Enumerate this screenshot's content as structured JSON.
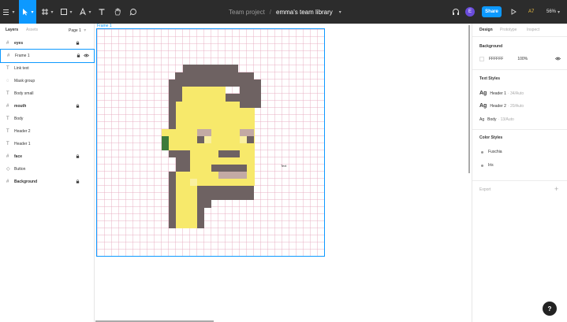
{
  "toolbar": {
    "project": "Team project",
    "separator": "/",
    "file_name": "emma's team library",
    "avatar_initial": "E",
    "share_label": "Share",
    "multiplayer_label": "A7",
    "zoom": "56%"
  },
  "left_panel": {
    "tabs": [
      "Layers",
      "Assets"
    ],
    "page_selector": "Page 1",
    "layers": [
      {
        "name": "eyes",
        "icon": "frame-grid-icon",
        "bold": true,
        "locked": true
      },
      {
        "name": "Frame 1",
        "icon": "frame-grid-icon",
        "bold": false,
        "locked": true,
        "selected": true,
        "visible_toggle": true
      },
      {
        "name": "Link text",
        "icon": "text-icon",
        "bold": false,
        "locked": false
      },
      {
        "name": "Mask group",
        "icon": "mask-icon",
        "bold": false,
        "locked": false
      },
      {
        "name": "Body small",
        "icon": "text-icon",
        "bold": false,
        "locked": false
      },
      {
        "name": "mouth",
        "icon": "frame-grid-icon",
        "bold": true,
        "locked": true
      },
      {
        "name": "Body",
        "icon": "text-icon",
        "bold": false,
        "locked": false
      },
      {
        "name": "Header 2",
        "icon": "text-icon",
        "bold": false,
        "locked": false
      },
      {
        "name": "Header 1",
        "icon": "text-icon",
        "bold": false,
        "locked": false
      },
      {
        "name": "face",
        "icon": "frame-grid-icon",
        "bold": true,
        "locked": true
      },
      {
        "name": "Button",
        "icon": "component-icon",
        "bold": false,
        "locked": false
      },
      {
        "name": "Background",
        "icon": "frame-grid-icon",
        "bold": true,
        "locked": true
      }
    ]
  },
  "canvas": {
    "frame_label": "Frame 1",
    "text_layer": "Text",
    "colors": {
      "hair": "#6e6262",
      "skin": "#f7e96b",
      "skin_light": "#faf0a0",
      "eye_light": "#c3aaa4",
      "green": "#3e7a3a",
      "teeth": "#c3aaa4"
    }
  },
  "right_panel": {
    "tabs": [
      "Design",
      "Prototype",
      "Inspect"
    ],
    "background_title": "Background",
    "background_hex": "FFFFFF",
    "background_opacity": "100%",
    "text_styles_title": "Text Styles",
    "text_styles": [
      {
        "ag": "Ag",
        "name": "Header 1",
        "desc": "· 34/Auto"
      },
      {
        "ag": "Ag",
        "name": "Header 2",
        "desc": "· 20/Auto"
      },
      {
        "ag": "Ag",
        "name": "Body",
        "desc": "· 13/Auto"
      }
    ],
    "color_styles_title": "Color Styles",
    "color_styles": [
      "Fuschia",
      "Iris"
    ],
    "export_label": "Export",
    "add_label": "+"
  },
  "help_label": "?"
}
